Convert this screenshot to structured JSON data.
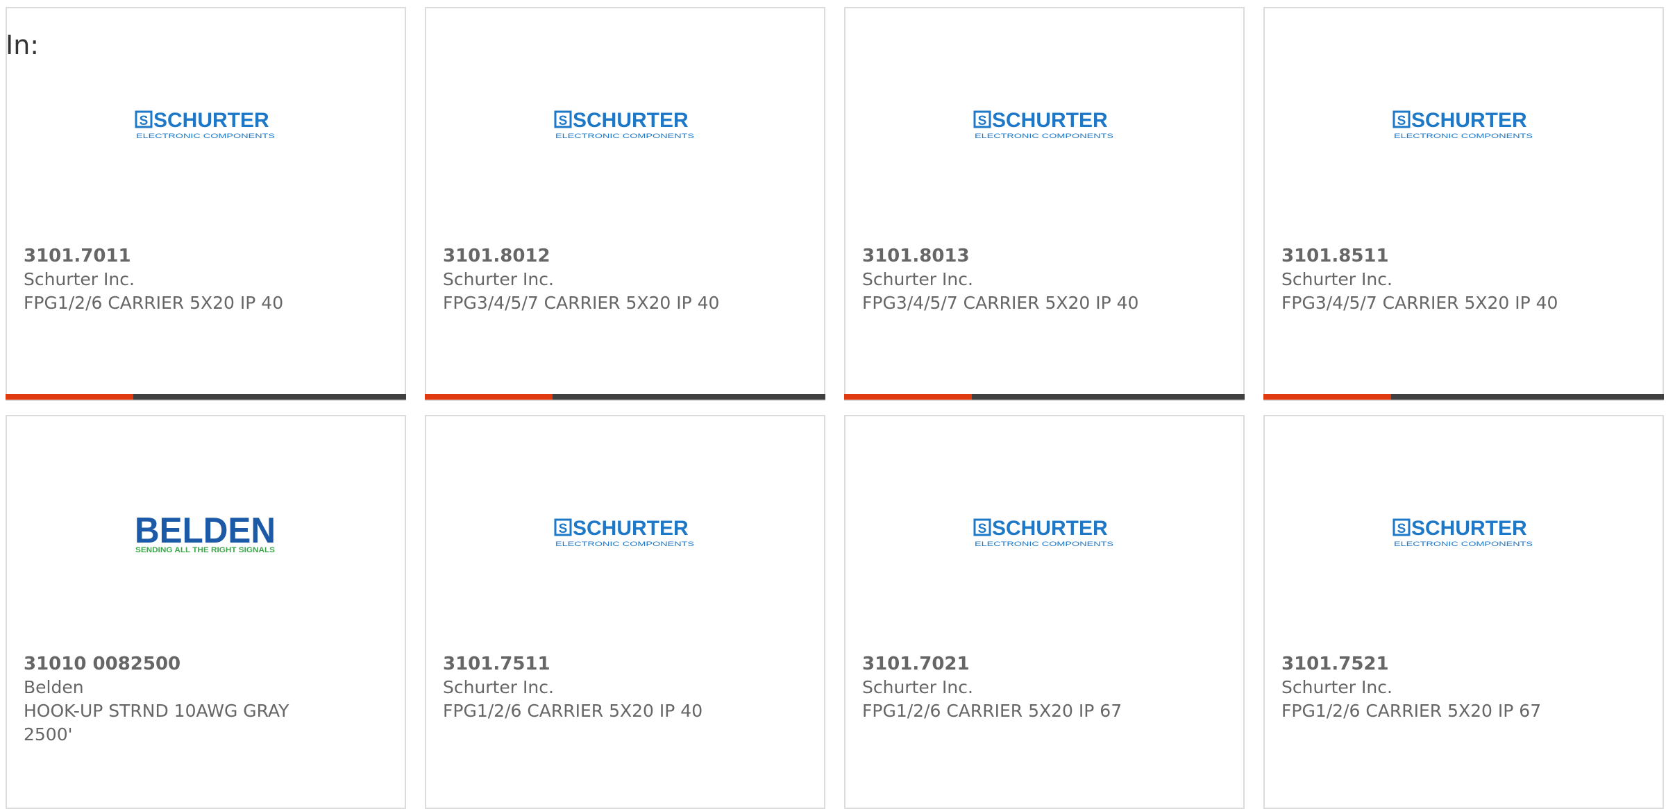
{
  "heading": "In:",
  "colors": {
    "schurter_blue": "#1e78c8",
    "belden_blue": "#1c5aa8",
    "belden_green": "#3aa84a",
    "accent_red": "#e03a10",
    "bar_dark": "#404040"
  },
  "products": [
    {
      "part_number": "3101.7011",
      "manufacturer": "Schurter Inc.",
      "description": "FPG1/2/6 CARRIER 5X20 IP 40",
      "logo": "schurter",
      "logo_text": "SCHURTER",
      "logo_subtext": "ELECTRONIC COMPONENTS",
      "has_bar": true
    },
    {
      "part_number": "3101.8012",
      "manufacturer": "Schurter Inc.",
      "description": "FPG3/4/5/7 CARRIER 5X20 IP 40",
      "logo": "schurter",
      "logo_text": "SCHURTER",
      "logo_subtext": "ELECTRONIC COMPONENTS",
      "has_bar": true
    },
    {
      "part_number": "3101.8013",
      "manufacturer": "Schurter Inc.",
      "description": "FPG3/4/5/7 CARRIER 5X20 IP 40",
      "logo": "schurter",
      "logo_text": "SCHURTER",
      "logo_subtext": "ELECTRONIC COMPONENTS",
      "has_bar": true
    },
    {
      "part_number": "3101.8511",
      "manufacturer": "Schurter Inc.",
      "description": "FPG3/4/5/7 CARRIER 5X20 IP 40",
      "logo": "schurter",
      "logo_text": "SCHURTER",
      "logo_subtext": "ELECTRONIC COMPONENTS",
      "has_bar": true
    },
    {
      "part_number": "31010 0082500",
      "manufacturer": "Belden",
      "description": "HOOK-UP STRND 10AWG GRAY 2500'",
      "logo": "belden",
      "logo_text": "BELDEN",
      "logo_subtext": "SENDING ALL THE RIGHT SIGNALS",
      "has_bar": false
    },
    {
      "part_number": "3101.7511",
      "manufacturer": "Schurter Inc.",
      "description": "FPG1/2/6 CARRIER 5X20 IP 40",
      "logo": "schurter",
      "logo_text": "SCHURTER",
      "logo_subtext": "ELECTRONIC COMPONENTS",
      "has_bar": false
    },
    {
      "part_number": "3101.7021",
      "manufacturer": "Schurter Inc.",
      "description": "FPG1/2/6 CARRIER 5X20 IP 67",
      "logo": "schurter",
      "logo_text": "SCHURTER",
      "logo_subtext": "ELECTRONIC COMPONENTS",
      "has_bar": false
    },
    {
      "part_number": "3101.7521",
      "manufacturer": "Schurter Inc.",
      "description": "FPG1/2/6 CARRIER 5X20 IP 67",
      "logo": "schurter",
      "logo_text": "SCHURTER",
      "logo_subtext": "ELECTRONIC COMPONENTS",
      "has_bar": false
    }
  ]
}
